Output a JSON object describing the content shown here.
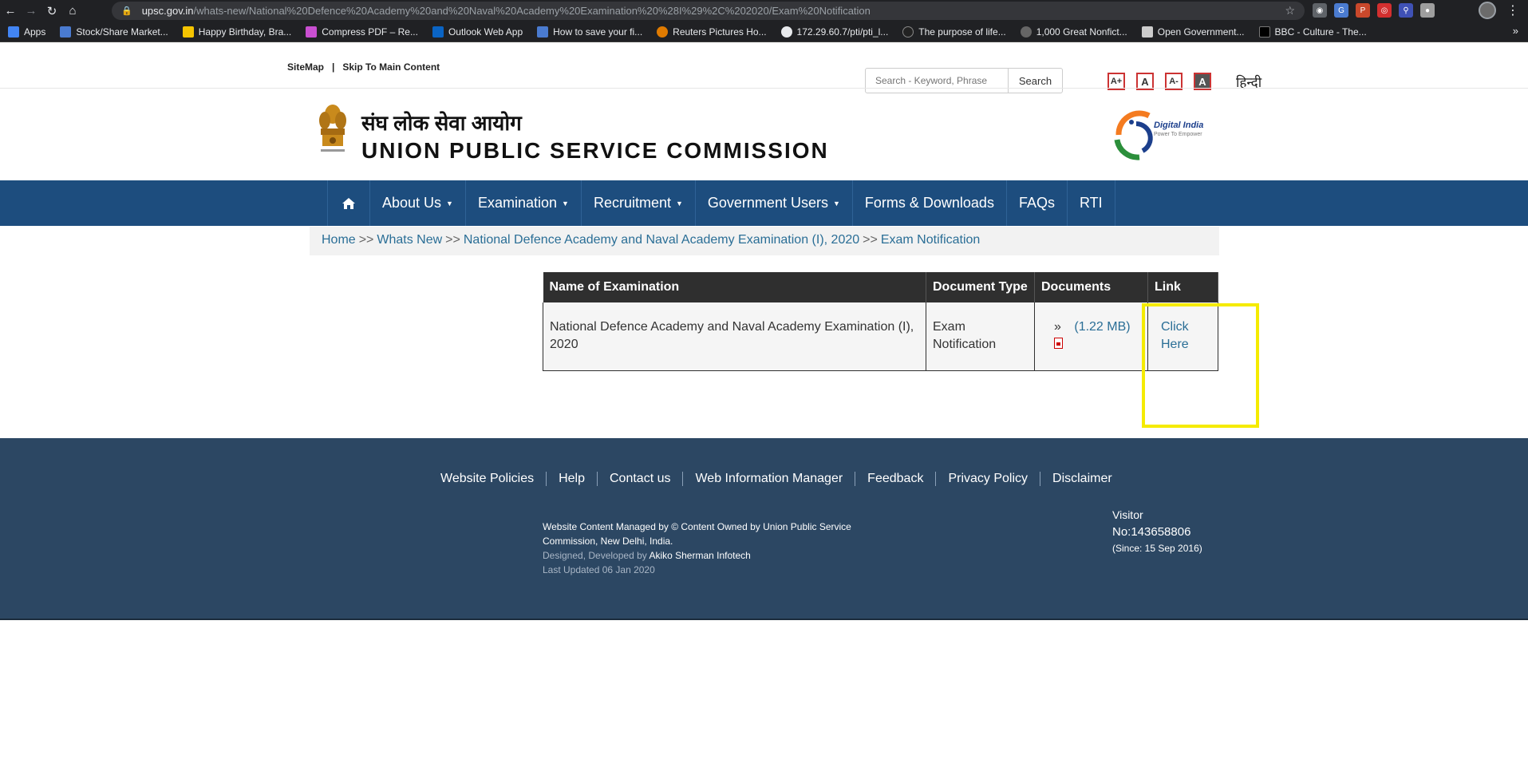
{
  "browser": {
    "url_domain": "upsc.gov.in",
    "url_path": "/whats-new/National%20Defence%20Academy%20and%20Naval%20Academy%20Examination%20%28I%29%2C%202020/Exam%20Notification",
    "bookmarks": [
      {
        "label": "Apps",
        "color": "#4285f4"
      },
      {
        "label": "Stock/Share Market...",
        "color": "#4a7bd0"
      },
      {
        "label": "Happy Birthday, Bra...",
        "color": "#f5c400"
      },
      {
        "label": "Compress PDF – Re...",
        "color": "#c94fd1"
      },
      {
        "label": "Outlook Web App",
        "color": "#0a64c4"
      },
      {
        "label": "How to save your fi...",
        "color": "#4a7bd0"
      },
      {
        "label": "Reuters Pictures Ho...",
        "color": "#e07b00"
      },
      {
        "label": "172.29.60.7/pti/pti_l...",
        "color": "#e8eaed"
      },
      {
        "label": "The purpose of life...",
        "color": "#222222"
      },
      {
        "label": "1,000 Great Nonfict...",
        "color": "#666666"
      },
      {
        "label": "Open Government...",
        "color": "#cccccc"
      },
      {
        "label": "BBC - Culture - The...",
        "color": "#000000"
      }
    ]
  },
  "utility": {
    "sitemap": "SiteMap",
    "separator": "|",
    "skip": "Skip To Main Content",
    "search_placeholder": "Search - Keyword, Phrase",
    "search_button": "Search",
    "font_increase": "A+",
    "font_normal": "A",
    "font_decrease": "A-",
    "contrast": "A",
    "language": "हिन्दी"
  },
  "header": {
    "title_hindi": "संघ लोक सेवा आयोग",
    "title_english": "UNION PUBLIC SERVICE COMMISSION",
    "digital_india": "Digital India",
    "digital_india_tagline": "Power To Empower"
  },
  "nav": {
    "items": [
      {
        "label": "About Us",
        "dropdown": true
      },
      {
        "label": "Examination",
        "dropdown": true
      },
      {
        "label": "Recruitment",
        "dropdown": true
      },
      {
        "label": "Government Users",
        "dropdown": true
      },
      {
        "label": "Forms & Downloads",
        "dropdown": false
      },
      {
        "label": "FAQs",
        "dropdown": false
      },
      {
        "label": "RTI",
        "dropdown": false
      }
    ]
  },
  "breadcrumb": {
    "home": "Home",
    "whats_new": "Whats New",
    "exam": "National Defence Academy and Naval Academy Examination (I), 2020",
    "current": "Exam Notification",
    "sep": ">>"
  },
  "table": {
    "headers": [
      "Name of Examination",
      "Document Type",
      "Documents",
      "Link"
    ],
    "row": {
      "name": "National Defence Academy and Naval Academy Examination (I), 2020",
      "doc_type": "Exam Notification",
      "doc_prefix": "»",
      "doc_size": "(1.22 MB)",
      "link": "Click Here"
    }
  },
  "footer": {
    "links": [
      "Website Policies",
      "Help",
      "Contact us",
      "Web Information Manager",
      "Feedback",
      "Privacy Policy",
      "Disclaimer"
    ],
    "managed": "Website Content Managed by © Content Owned by Union Public Service Commission, New Delhi, India.",
    "designed_prefix": "Designed, Developed by",
    "designed_by": "Akiko Sherman Infotech",
    "updated": "Last Updated 06 Jan 2020",
    "visitor_label": "Visitor",
    "visitor_count": "No:143658806",
    "visitor_since": "(Since: 15 Sep 2016)"
  }
}
